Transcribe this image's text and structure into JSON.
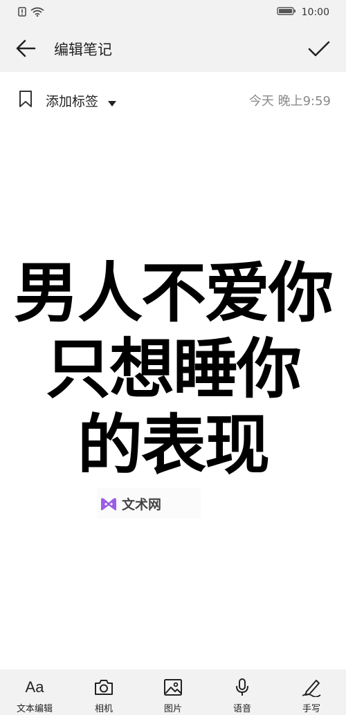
{
  "status": {
    "time": "10:00"
  },
  "header": {
    "title": "编辑笔记"
  },
  "tag_row": {
    "label": "添加标签",
    "timestamp": "今天 晚上9:59"
  },
  "note": {
    "lines": [
      "男人不爱你",
      "只想睡你",
      "的表现"
    ]
  },
  "watermark": {
    "text": "文术网"
  },
  "bottom_toolbar": {
    "items": [
      {
        "label": "文本编辑",
        "icon_glyph": "Aa",
        "icon": "text-format-icon"
      },
      {
        "label": "相机",
        "icon": "camera-icon"
      },
      {
        "label": "图片",
        "icon": "image-icon"
      },
      {
        "label": "语音",
        "icon": "microphone-icon"
      },
      {
        "label": "手写",
        "icon": "handwriting-pen-icon"
      }
    ]
  },
  "colors": {
    "bar_bg": "#f2f2f2",
    "text": "#111111",
    "timestamp": "#8a8a8a",
    "watermark_logo": "#9b5de5"
  }
}
